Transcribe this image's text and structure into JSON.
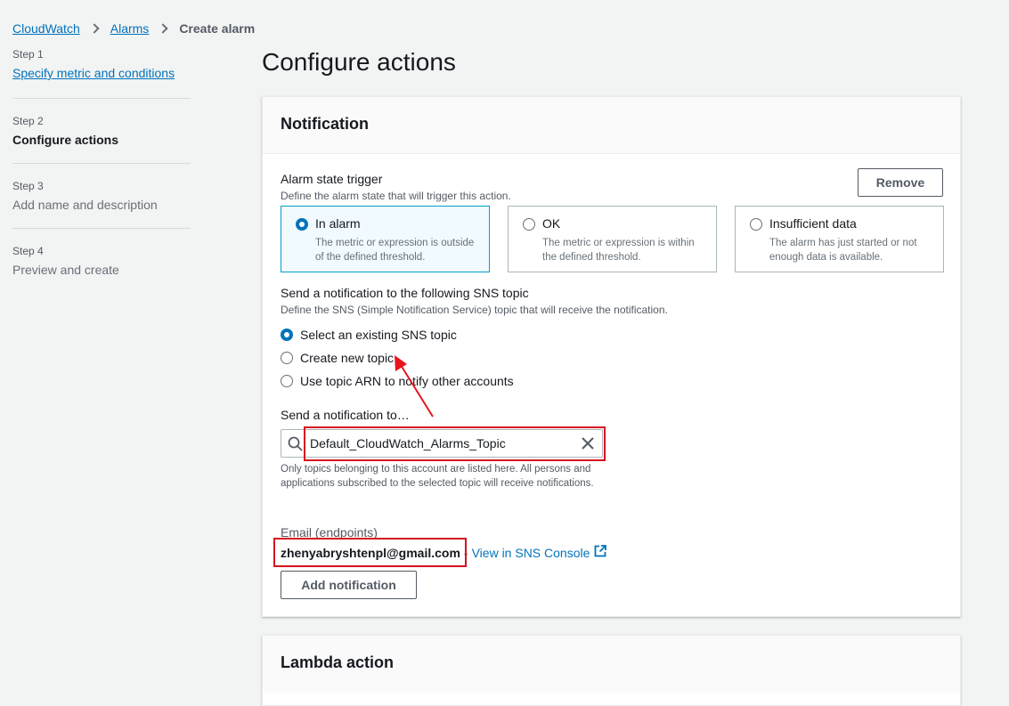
{
  "breadcrumb": {
    "items": [
      "CloudWatch",
      "Alarms"
    ],
    "current": "Create alarm"
  },
  "steps": [
    {
      "num": "Step 1",
      "title": "Specify metric and conditions"
    },
    {
      "num": "Step 2",
      "title": "Configure actions"
    },
    {
      "num": "Step 3",
      "title": "Add name and description"
    },
    {
      "num": "Step 4",
      "title": "Preview and create"
    }
  ],
  "page_title": "Configure actions",
  "notification": {
    "header": "Notification",
    "trigger_label": "Alarm state trigger",
    "trigger_desc": "Define the alarm state that will trigger this action.",
    "remove_label": "Remove",
    "tiles": [
      {
        "label": "In alarm",
        "desc": "The metric or expression is outside of the defined threshold.",
        "selected": true
      },
      {
        "label": "OK",
        "desc": "The metric or expression is within the defined threshold.",
        "selected": false
      },
      {
        "label": "Insufficient data",
        "desc": "The alarm has just started or not enough data is available.",
        "selected": false
      }
    ],
    "sns_label": "Send a notification to the following SNS topic",
    "sns_desc": "Define the SNS (Simple Notification Service) topic that will receive the notification.",
    "sns_options": [
      {
        "label": "Select an existing SNS topic",
        "selected": true
      },
      {
        "label": "Create new topic",
        "selected": false
      },
      {
        "label": "Use topic ARN to notify other accounts",
        "selected": false
      }
    ],
    "send_to_label": "Send a notification to…",
    "topic_value": "Default_CloudWatch_Alarms_Topic",
    "hint": "Only topics belonging to this account are listed here. All persons and applications subscribed to the selected topic will receive notifications.",
    "email_label": "Email (endpoints)",
    "email_value": "zhenyabryshtenpl@gmail.com",
    "email_separator": "-",
    "sns_console_link": "View in SNS Console",
    "add_notification_label": "Add notification"
  },
  "lambda": {
    "header": "Lambda action"
  },
  "colors": {
    "link": "#0073bb",
    "highlight": "#d6121f",
    "selected_tile_bg": "#f1faff"
  }
}
